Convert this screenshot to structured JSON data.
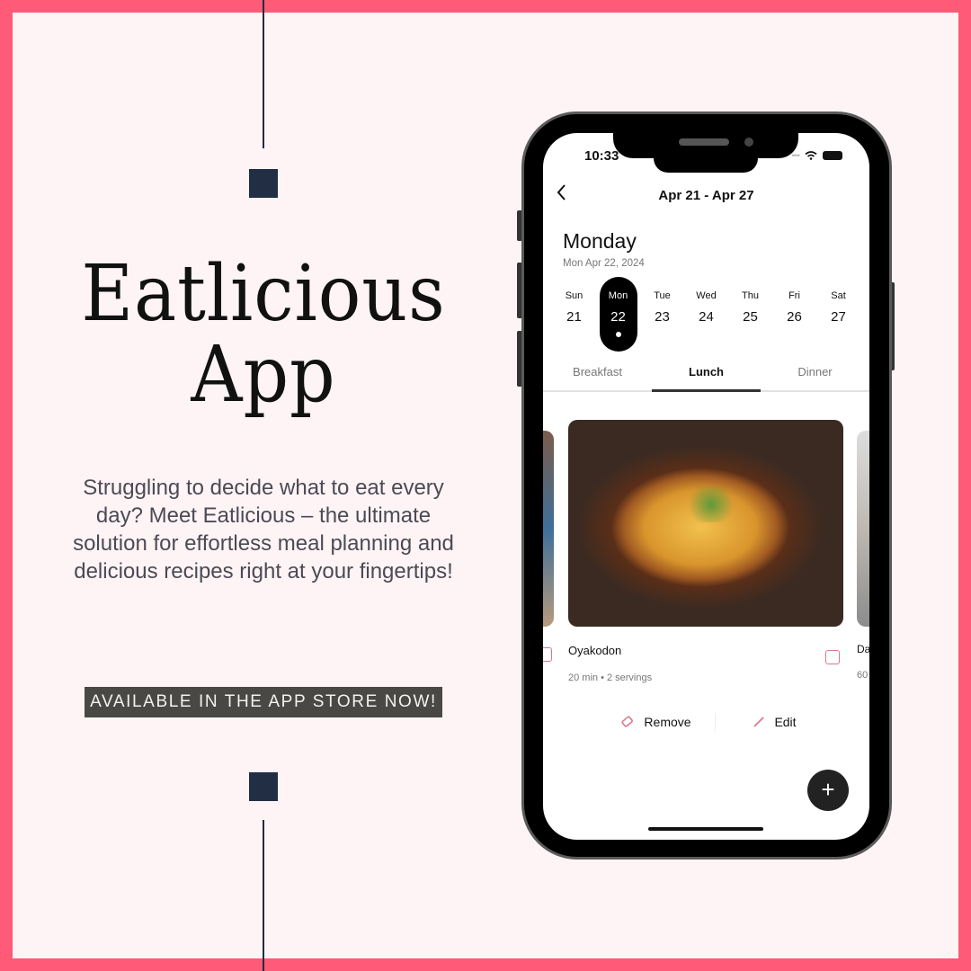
{
  "poster": {
    "title_line1": "Eatlicious",
    "title_line2": "App",
    "description": "Struggling to decide what to eat every day? Meet Eatlicious – the ultimate solution for effortless meal planning and delicious recipes right at your fingertips!",
    "badge": "AVAILABLE IN THE APP STORE NOW!",
    "colors": {
      "border": "#FF5A78",
      "background": "#FFF4F5",
      "accent": "#222E44"
    }
  },
  "app": {
    "status_bar": {
      "time": "10:33"
    },
    "header": {
      "back_icon": "chevron-left-icon",
      "title": "Apr 21 - Apr 27"
    },
    "day": {
      "title": "Monday",
      "subtitle": "Mon Apr 22, 2024"
    },
    "week": [
      {
        "name": "Sun",
        "date": "21",
        "selected": false
      },
      {
        "name": "Mon",
        "date": "22",
        "selected": true
      },
      {
        "name": "Tue",
        "date": "23",
        "selected": false
      },
      {
        "name": "Wed",
        "date": "24",
        "selected": false
      },
      {
        "name": "Thu",
        "date": "25",
        "selected": false
      },
      {
        "name": "Fri",
        "date": "26",
        "selected": false
      },
      {
        "name": "Sat",
        "date": "27",
        "selected": false
      }
    ],
    "tabs": [
      {
        "label": "Breakfast",
        "active": false
      },
      {
        "label": "Lunch",
        "active": true
      },
      {
        "label": "Dinner",
        "active": false
      }
    ],
    "meal": {
      "name": "Oyakodon",
      "meta": "20 min • 2 servings"
    },
    "next_meal_peek": {
      "name": "Da",
      "meta": "60"
    },
    "actions": {
      "remove": "Remove",
      "edit": "Edit"
    },
    "fab": "+"
  }
}
